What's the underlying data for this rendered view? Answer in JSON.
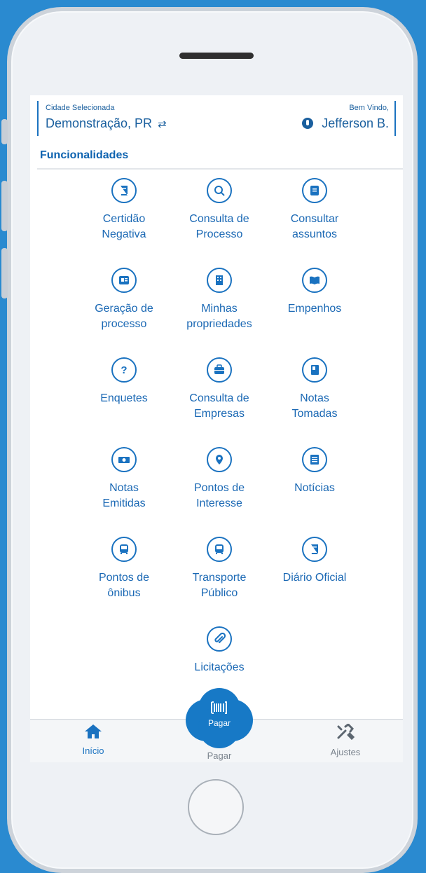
{
  "header": {
    "city_label": "Cidade Selecionada",
    "city_value": "Demonstração, PR",
    "swap_glyph": "⇄",
    "welcome_label": "Bem Vindo,",
    "user_name": "Jefferson B."
  },
  "section_title": "Funcionalidades",
  "features": [
    {
      "label": "Certidão\nNegativa",
      "icon": "book-icon"
    },
    {
      "label": "Consulta de\nProcesso",
      "icon": "search-icon"
    },
    {
      "label": "Consultar\nassuntos",
      "icon": "document-icon"
    },
    {
      "label": "Geração de\nprocesso",
      "icon": "newspaper-icon"
    },
    {
      "label": "Minhas\npropriedades",
      "icon": "building-icon"
    },
    {
      "label": "Empenhos",
      "icon": "book-open-icon"
    },
    {
      "label": "Enquetes",
      "icon": "question-icon"
    },
    {
      "label": "Consulta de\nEmpresas",
      "icon": "briefcase-icon"
    },
    {
      "label": "Notas\nTomadas",
      "icon": "notebook-icon"
    },
    {
      "label": "Notas\nEmitidas",
      "icon": "money-icon"
    },
    {
      "label": "Pontos de\nInteresse",
      "icon": "map-pin-icon"
    },
    {
      "label": "Notícias",
      "icon": "news-icon"
    },
    {
      "label": "Pontos de\nônibus",
      "icon": "bus-icon"
    },
    {
      "label": "Transporte\nPúblico",
      "icon": "bus-icon"
    },
    {
      "label": "Diário Oficial",
      "icon": "book-icon"
    },
    {
      "label": "Licitações",
      "icon": "paperclip-icon"
    }
  ],
  "bottom_nav": {
    "home_label": "Início",
    "pay_label": "Pagar",
    "pay_bubble_label": "Pagar",
    "settings_label": "Ajustes"
  },
  "colors": {
    "background": "#2a8ad0",
    "accent": "#1a72c0",
    "pay_bubble": "#1779c6"
  }
}
